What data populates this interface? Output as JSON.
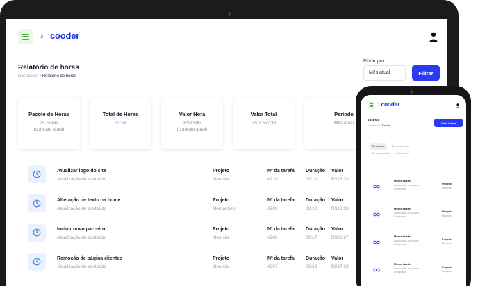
{
  "app": {
    "logo_text": "cooder"
  },
  "header": {
    "page_title": "Relatório de horas",
    "breadcrumb_root": "Dashboard",
    "breadcrumb_sep": "•",
    "breadcrumb_current": "Relatório de horas"
  },
  "filter": {
    "label": "Filtrar por:",
    "selected": "Mês atual",
    "button": "Filtrar"
  },
  "cards": [
    {
      "title": "Pacote de Horas",
      "line1": "25 Horas",
      "line2": "(contrato atual)"
    },
    {
      "title": "Total de Horas",
      "line1": "31:58",
      "line2": ""
    },
    {
      "title": "Valor Hora",
      "line1": "R$80,00",
      "line2": "(contrato atual)"
    },
    {
      "title": "Valor Total",
      "line1": "R$ 2.557,33",
      "line2": ""
    },
    {
      "title": "Período",
      "line1": "Mês atual",
      "line2": ""
    }
  ],
  "columns": {
    "project": "Projeto",
    "task_number": "Nº da tarefa",
    "duration": "Duração",
    "value": "Valor"
  },
  "tasks": [
    {
      "title": "Atualizar logo do site",
      "subtitle": "Atualização de conteúdo",
      "project": "Meu site",
      "number": "#210",
      "duration": "00:10",
      "value": "R$13,33"
    },
    {
      "title": "Alteração de texto na home",
      "subtitle": "Atualização de conteúdo",
      "project": "Meu projeto",
      "number": "#209",
      "duration": "00:10",
      "value": "R$13,33"
    },
    {
      "title": "Incluir novo parceiro",
      "subtitle": "Atualização de conteúdo",
      "project": "Meu site",
      "number": "#208",
      "duration": "00:17",
      "value": "R$22,67"
    },
    {
      "title": "Remoção de página clientes",
      "subtitle": "Atualização de conteúdo",
      "project": "Meu site",
      "number": "#207",
      "duration": "00:28",
      "value": "R$37,33"
    }
  ],
  "mobile": {
    "logo_text": "cooder",
    "page_title": "Tarefas",
    "breadcrumb_root": "Dashboard",
    "breadcrumb_sep": "•",
    "breadcrumb_current": "Tarefas",
    "create_button": "Criar tarefa",
    "tabs": [
      "Em aberto",
      "Em andamento",
      "Em aprovação",
      "Concluída"
    ],
    "tasks": [
      {
        "title": "Minha tarefa",
        "subtitle": "Atualização de plugins Wordpress",
        "col": "Projeto",
        "project": "Meu site"
      },
      {
        "title": "Minha tarefa",
        "subtitle": "Atualização de plugins Wordpress",
        "col": "Projeto",
        "project": "Meu site"
      },
      {
        "title": "Minha tarefa",
        "subtitle": "Atualização de plugins Wordpress",
        "col": "Projeto",
        "project": "Meu site"
      },
      {
        "title": "Minha tarefa",
        "subtitle": "Atualização de plugins Wordpress",
        "col": "Projeto",
        "project": "Meu proj"
      }
    ]
  },
  "colors": {
    "accent": "#2b3cf0",
    "brand": "#1a35e6",
    "menu_bg": "#eaf7e3",
    "menu_lines": "#4caf50",
    "icon_bg": "#e9f2fd"
  },
  "icons": {
    "menu": "hamburger-icon",
    "user": "user-icon",
    "task": "clock-icon",
    "mobile_task": "infinity-icon"
  }
}
